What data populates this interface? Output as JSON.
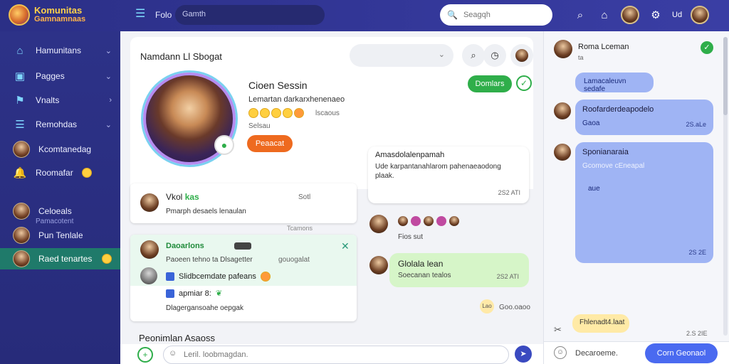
{
  "brand": {
    "line1": "Komunitas",
    "line2": "Gamnamnaas"
  },
  "topbar": {
    "title": "Folo",
    "left_search": "Gamth",
    "search_placeholder": "Seagqh",
    "username": "Ud"
  },
  "sidebar": {
    "items": [
      {
        "label": "Hamunitans",
        "icon": "home-icon"
      },
      {
        "label": "Pagges",
        "icon": "pages-icon"
      },
      {
        "label": "Vnalts",
        "icon": "vault-icon"
      },
      {
        "label": "Remohdas",
        "icon": "list-icon"
      },
      {
        "label": "Kcomtanedag",
        "icon": "avatar"
      },
      {
        "label": "Roomafar",
        "icon": "bell-icon"
      },
      {
        "label": "Celoeals",
        "icon": "avatar"
      },
      {
        "label": "Pun Tenlale",
        "icon": "avatar"
      },
      {
        "label": "Raed tenartes",
        "icon": "avatar"
      }
    ],
    "sub_label": "Pamacotent"
  },
  "main": {
    "title": "Namdann Ll Sbogat",
    "profile": {
      "name": "Cioen Sessin",
      "subtitle": "Lemartan darkarxhenenaeo",
      "count": "lscaous",
      "meta": "Selsau",
      "follow_label": "Peaacat",
      "join_label": "Domlars"
    },
    "post1": {
      "name": "Vkol",
      "name_tag": "kas",
      "time": "Sotl",
      "text": "Pmarph desaels lenaulan",
      "tag": "Tcamons"
    },
    "post2": {
      "name": "Daoarlons",
      "meta1": "Paoeen tehno ta Dlsagetter",
      "meta2": "gouogalat",
      "row1": "Slidbcemdate pafeans",
      "row2": "apmiar 8:",
      "foot": "Dlagergansoahe oepgak"
    },
    "section_title": "Peonimlan Asaoss",
    "message_card": {
      "title": "Amasdolalenpamah",
      "body": "Ude karpantanahlarom pahenaeaodong plaak.",
      "time": "2S2 ATI"
    },
    "emoji_row_label": "Fios sut",
    "green_bubble": {
      "title": "Glolala lean",
      "sub": "Soecanan tealos",
      "time": "2S2 ATI"
    },
    "reaction": {
      "pill": "Lao",
      "time": "Goo.oaoo"
    },
    "composer_placeholder": "Leril. loobmagdan."
  },
  "chat": {
    "header_name": "Roma Lceman",
    "header_sub": "ta",
    "bubble1": "Lamacaleuvn sedafe",
    "bubble2": {
      "line1": "Roofarderdeapodelo",
      "line2": "Gaoa",
      "time": "2S.aLe"
    },
    "bubble3": {
      "line1": "Sponianaraia",
      "line2": "Gcomove cEneapal",
      "line3": "aue",
      "time": "2S 2E"
    },
    "bubble4": "Fhlenadt4.laat",
    "time": "2.S 2IE",
    "composer_text": "Decaroeme.",
    "composer_button": "Corn Geonaol"
  }
}
